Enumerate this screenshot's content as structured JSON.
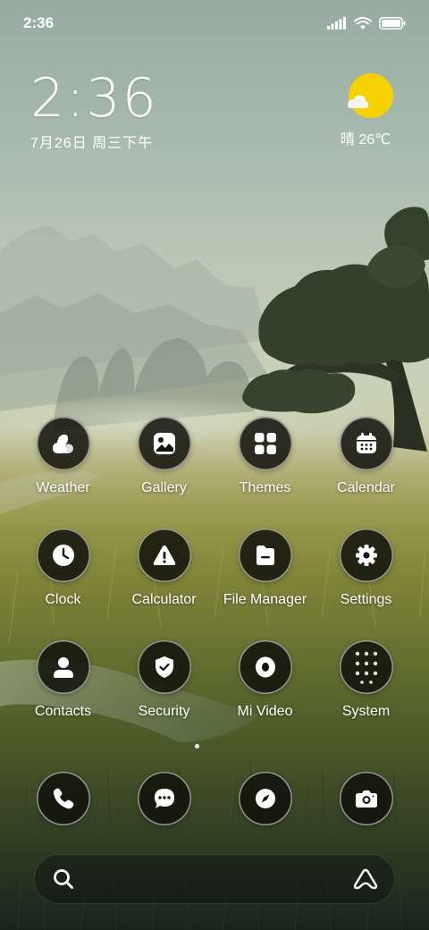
{
  "status_bar": {
    "time": "2:36",
    "icons": [
      "signal-icon",
      "wifi-icon",
      "battery-icon"
    ]
  },
  "clock_widget": {
    "time": "2:36",
    "date": "7月26日 周三下午"
  },
  "weather_widget": {
    "icon": "partly-sunny-icon",
    "text": "晴 26℃"
  },
  "apps": [
    {
      "label": "Weather",
      "icon": "weather-icon"
    },
    {
      "label": "Gallery",
      "icon": "gallery-icon"
    },
    {
      "label": "Themes",
      "icon": "themes-icon"
    },
    {
      "label": "Calendar",
      "icon": "calendar-icon"
    },
    {
      "label": "Clock",
      "icon": "clock-icon"
    },
    {
      "label": "Calculator",
      "icon": "warning-icon"
    },
    {
      "label": "File Manager",
      "icon": "folder-icon"
    },
    {
      "label": "Settings",
      "icon": "gear-icon"
    },
    {
      "label": "Contacts",
      "icon": "person-icon"
    },
    {
      "label": "Security",
      "icon": "shield-icon"
    },
    {
      "label": "Mi Video",
      "icon": "video-icon"
    },
    {
      "label": "System",
      "icon": "folder-grid-icon"
    }
  ],
  "dock": [
    {
      "icon": "phone-icon"
    },
    {
      "icon": "message-icon"
    },
    {
      "icon": "compass-icon"
    },
    {
      "icon": "camera-icon"
    }
  ],
  "search_bar": {
    "left_icon": "search-icon",
    "right_icon": "assistant-icon"
  },
  "colors": {
    "sun": "#f5d100",
    "icon_bg": "#14140c"
  }
}
